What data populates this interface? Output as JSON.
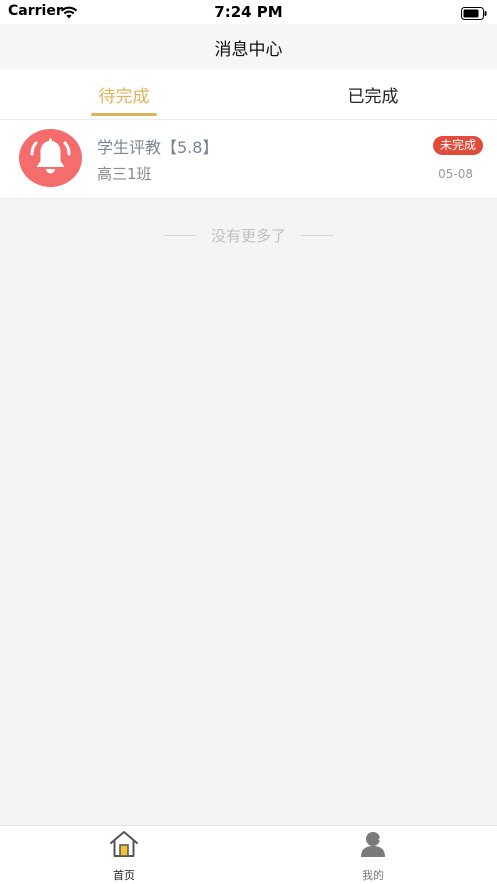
{
  "status_bar": {
    "carrier": "Carrier",
    "time": "7:24 PM",
    "wifi_icon": "wifi-icon",
    "battery_icon": "battery-icon"
  },
  "nav": {
    "title": "消息中心"
  },
  "tabs": [
    {
      "label": "待完成",
      "active": true
    },
    {
      "label": "已完成",
      "active": false
    }
  ],
  "messages": [
    {
      "icon": "bell-icon",
      "title": "学生评教【5.8】",
      "subtitle": "高三1班",
      "status": "未完成",
      "date": "05-08"
    }
  ],
  "list_footer": {
    "no_more_text": "没有更多了"
  },
  "tab_bar": {
    "items": [
      {
        "label": "首页",
        "icon": "home-icon",
        "active": true
      },
      {
        "label": "我的",
        "icon": "user-icon",
        "active": false
      }
    ]
  },
  "colors": {
    "accent": "#e0b25c",
    "badge": "#e04b3b",
    "bell_bg": "#f46c6c",
    "background": "#f4f4f4"
  }
}
